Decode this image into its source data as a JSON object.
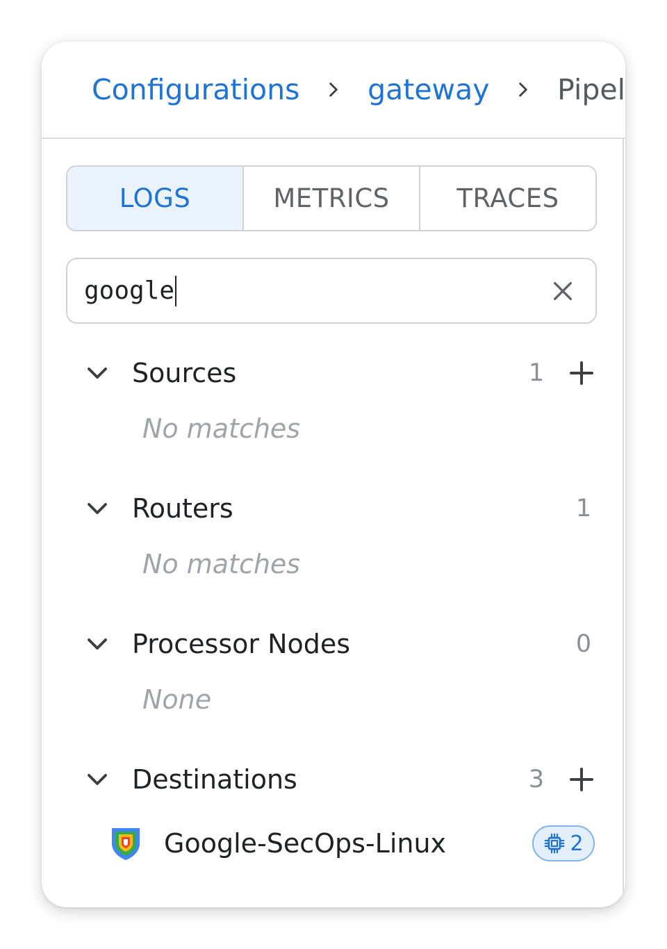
{
  "breadcrumb": {
    "items": [
      {
        "label": "Configurations"
      },
      {
        "label": "gateway"
      }
    ],
    "current": "Pipel"
  },
  "tabs": [
    {
      "label": "LOGS",
      "active": true
    },
    {
      "label": "METRICS",
      "active": false
    },
    {
      "label": "TRACES",
      "active": false
    }
  ],
  "search": {
    "value": "google",
    "clear_icon": "close-icon"
  },
  "sections": {
    "sources": {
      "title": "Sources",
      "count": "1",
      "empty": "No matches",
      "has_add": true
    },
    "routers": {
      "title": "Routers",
      "count": "1",
      "empty": "No matches",
      "has_add": false
    },
    "processors": {
      "title": "Processor Nodes",
      "count": "0",
      "empty": "None",
      "has_add": false
    },
    "destinations": {
      "title": "Destinations",
      "count": "3",
      "has_add": true,
      "items": [
        {
          "label": "Google-SecOps-Linux",
          "icon": "google-secops-shield-icon",
          "badge_icon": "processor-chip-icon",
          "badge_count": "2"
        }
      ]
    }
  },
  "colors": {
    "accent": "#1f73d2",
    "active_tab_bg": "#eaf2fd",
    "muted_text": "#a0a4a9",
    "badge_bg": "#e3effd",
    "badge_border": "#7fb3ec"
  }
}
